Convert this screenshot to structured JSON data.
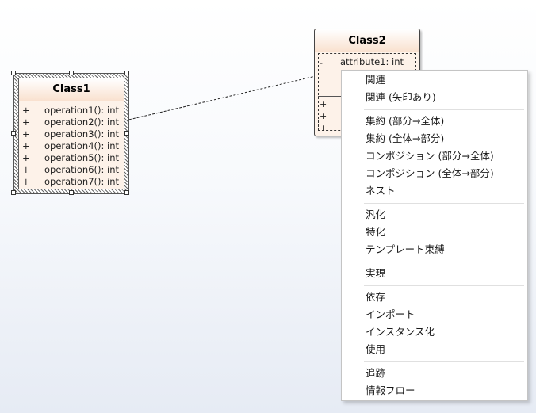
{
  "class1": {
    "title": "Class1",
    "operations": [
      {
        "vis": "+",
        "text": "operation1(): int"
      },
      {
        "vis": "+",
        "text": "operation2(): int"
      },
      {
        "vis": "+",
        "text": "operation3(): int"
      },
      {
        "vis": "+",
        "text": "operation4(): int"
      },
      {
        "vis": "+",
        "text": "operation5(): int"
      },
      {
        "vis": "+",
        "text": "operation6(): int"
      },
      {
        "vis": "+",
        "text": "operation7(): int"
      }
    ]
  },
  "class2": {
    "title": "Class2",
    "attribute": "attribute1: int",
    "attr_vis": "-",
    "op_vis": "+"
  },
  "context_menu": {
    "groups": [
      [
        "関連",
        "関連 (矢印あり)"
      ],
      [
        "集約 (部分→全体)",
        "集約 (全体→部分)",
        "コンポジション (部分→全体)",
        "コンポジション (全体→部分)",
        "ネスト"
      ],
      [
        "汎化",
        "特化",
        "テンプレート束縛"
      ],
      [
        "実現"
      ],
      [
        "依存",
        "インポート",
        "インスタンス化",
        "使用"
      ],
      [
        "追跡",
        "情報フロー"
      ]
    ]
  },
  "colors": {
    "class_fill": "#fdf2e9",
    "class_header": "#f9e1cf",
    "menu_bg": "#ffffff"
  }
}
